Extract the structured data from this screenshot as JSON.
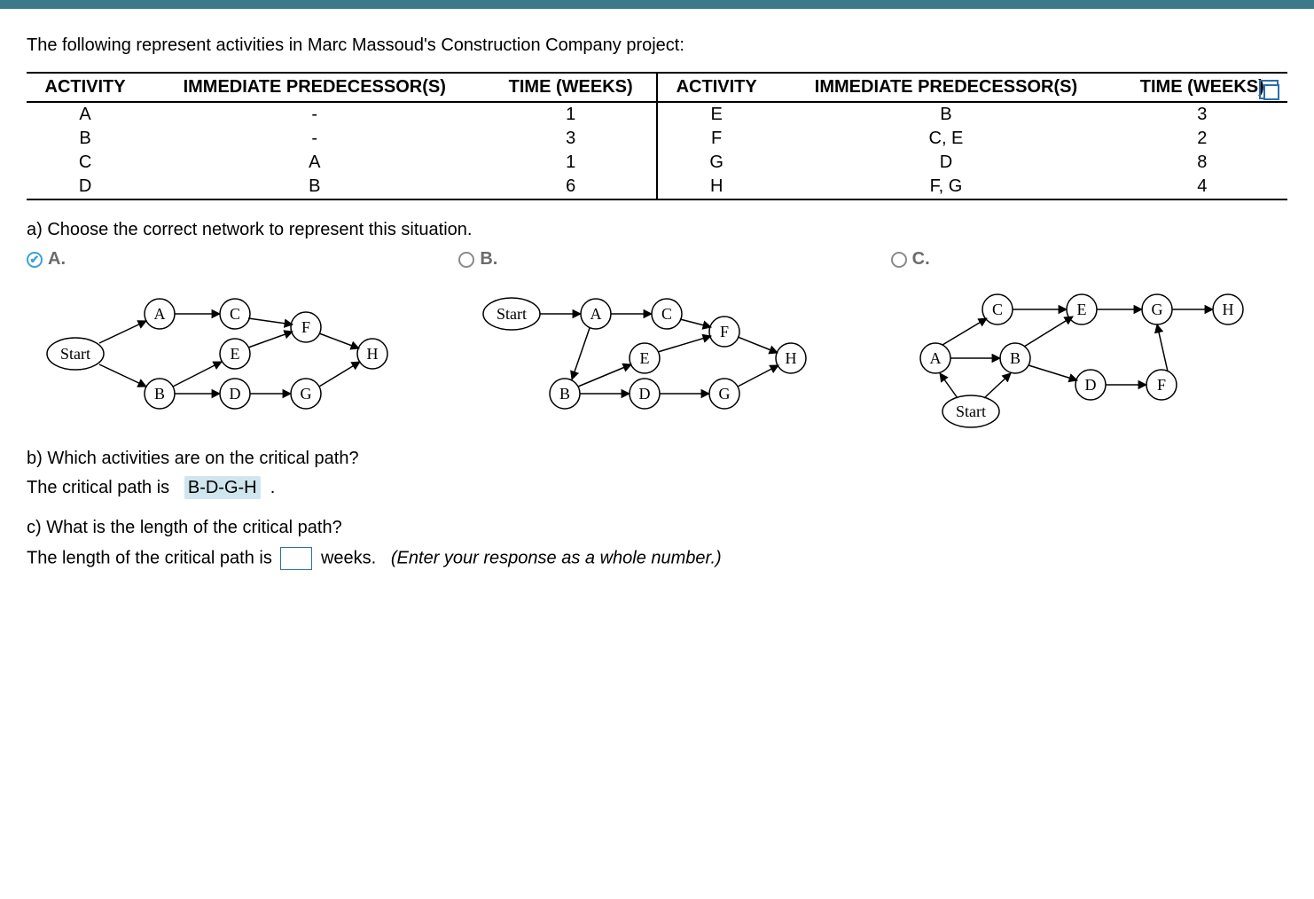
{
  "intro": "The following represent activities in Marc Massoud's Construction Company project:",
  "table": {
    "headers": {
      "activity": "ACTIVITY",
      "pred": "IMMEDIATE PREDECESSOR(S)",
      "time": "TIME (WEEKS)"
    },
    "left": [
      {
        "act": "A",
        "pred": "-",
        "time": "1"
      },
      {
        "act": "B",
        "pred": "-",
        "time": "3"
      },
      {
        "act": "C",
        "pred": "A",
        "time": "1"
      },
      {
        "act": "D",
        "pred": "B",
        "time": "6"
      }
    ],
    "right": [
      {
        "act": "E",
        "pred": "B",
        "time": "3"
      },
      {
        "act": "F",
        "pred": "C, E",
        "time": "2"
      },
      {
        "act": "G",
        "pred": "D",
        "time": "8"
      },
      {
        "act": "H",
        "pred": "F, G",
        "time": "4"
      }
    ]
  },
  "partA": {
    "prompt": "a) Choose the correct network to represent this situation.",
    "options": {
      "A": "A.",
      "B": "B.",
      "C": "C."
    },
    "selected": "A"
  },
  "diagram": {
    "start": "Start",
    "nodes": [
      "A",
      "B",
      "C",
      "D",
      "E",
      "F",
      "G",
      "H"
    ]
  },
  "partB": {
    "prompt": "b) Which activities are on the critical path?",
    "lead": "The critical path is",
    "answer": "B-D-G-H",
    "tail": "."
  },
  "partC": {
    "prompt": "c) What is the length of the critical path?",
    "lead": "The length of the critical path is",
    "unit": "weeks.",
    "hint": "(Enter your response as a whole number.)"
  },
  "chart_data": {
    "type": "table",
    "title": "Activity precedence and durations",
    "columns": [
      "Activity",
      "Immediate Predecessor(s)",
      "Time (weeks)"
    ],
    "rows": [
      [
        "A",
        "-",
        1
      ],
      [
        "B",
        "-",
        3
      ],
      [
        "C",
        "A",
        1
      ],
      [
        "D",
        "B",
        6
      ],
      [
        "E",
        "B",
        3
      ],
      [
        "F",
        "C, E",
        2
      ],
      [
        "G",
        "D",
        8
      ],
      [
        "H",
        "F, G",
        4
      ]
    ]
  }
}
